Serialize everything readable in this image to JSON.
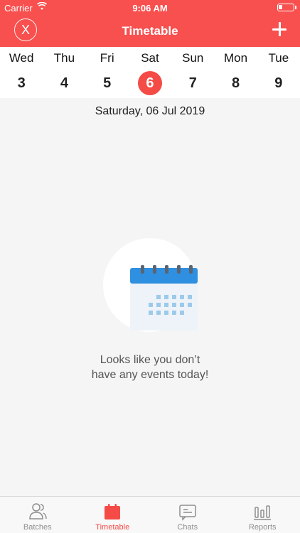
{
  "status_bar": {
    "carrier": "Carrier",
    "time": "9:06 AM"
  },
  "header": {
    "title": "Timetable",
    "close_label": "X"
  },
  "week": [
    {
      "name": "Wed",
      "num": "3"
    },
    {
      "name": "Thu",
      "num": "4"
    },
    {
      "name": "Fri",
      "num": "5"
    },
    {
      "name": "Sat",
      "num": "6",
      "selected": true
    },
    {
      "name": "Sun",
      "num": "7"
    },
    {
      "name": "Mon",
      "num": "8"
    },
    {
      "name": "Tue",
      "num": "9"
    }
  ],
  "selected_date_label": "Saturday, 06 Jul 2019",
  "empty_state": {
    "line1": "Looks like you don’t",
    "line2": "have any events today!"
  },
  "tabs": [
    {
      "label": "Batches",
      "icon": "people-icon"
    },
    {
      "label": "Timetable",
      "icon": "calendar-icon",
      "active": true
    },
    {
      "label": "Chats",
      "icon": "chat-icon"
    },
    {
      "label": "Reports",
      "icon": "reports-icon"
    }
  ],
  "colors": {
    "accent": "#f7504f",
    "selected_day": "#f44b47",
    "calendar_blue": "#2f8fe0"
  }
}
